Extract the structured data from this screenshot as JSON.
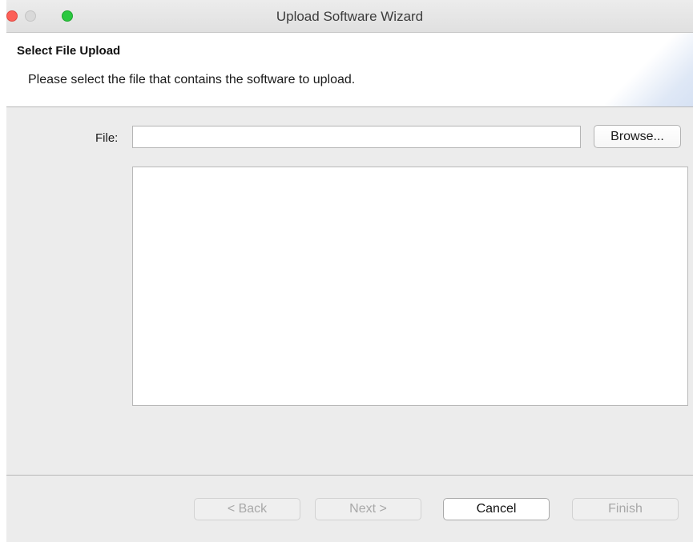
{
  "window": {
    "title": "Upload Software Wizard"
  },
  "header": {
    "title": "Select File Upload",
    "description": "Please select the file that contains the software to upload."
  },
  "file": {
    "label": "File:",
    "value": "",
    "browse_label": "Browse..."
  },
  "footer": {
    "back_label": "< Back",
    "next_label": "Next >",
    "cancel_label": "Cancel",
    "finish_label": "Finish"
  },
  "colors": {
    "close": "#fc5f57",
    "minimize": "#d9d9d9",
    "zoom": "#2bc840",
    "window_bg": "#ececec"
  }
}
